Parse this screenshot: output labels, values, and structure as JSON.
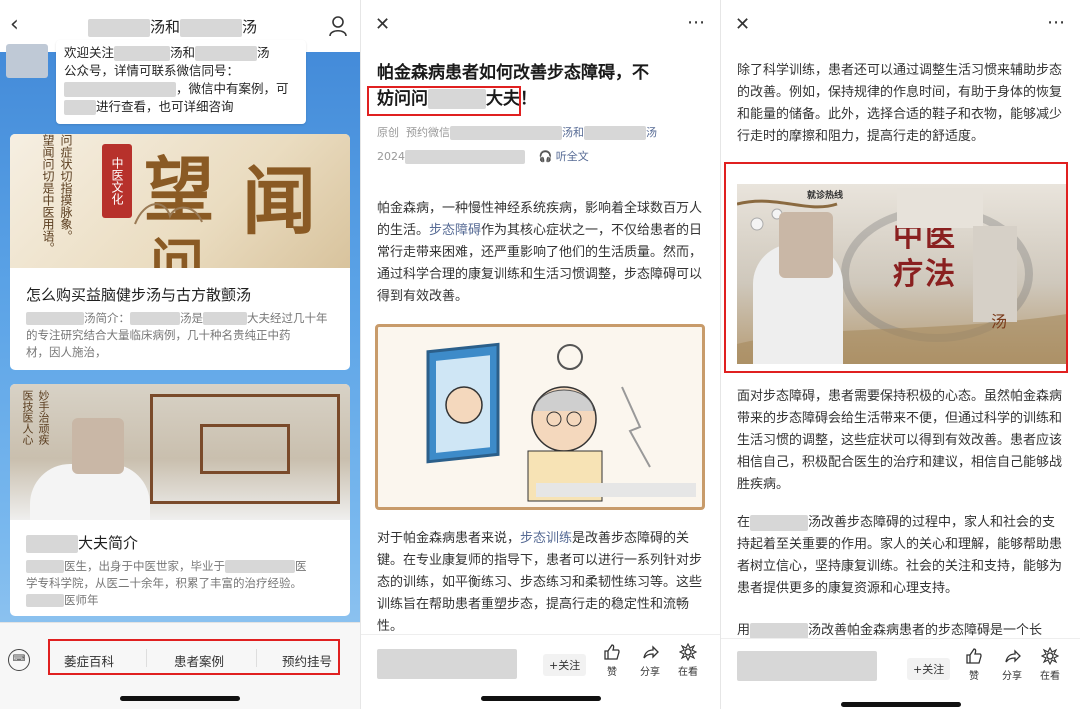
{
  "panel1": {
    "nav_title_a": "汤和",
    "nav_title_b": "汤",
    "welcome": {
      "line1a": "欢迎关注",
      "line1b": "汤和",
      "line1c": "汤",
      "line2": "公众号，详情可联系微信同号：",
      "line3": "，微信中有案例，可",
      "line4": "进行查看，也可详细咨询"
    },
    "card1": {
      "image_vertical_1": "望闻问切是中医用语。",
      "image_vertical_2": "指望气色、闻听声息、",
      "image_vertical_3": "问症状切指摸脉象。",
      "image_tag": "中医文化",
      "image_big_1": "望",
      "image_big_2": "闻",
      "image_big_3": "问",
      "title": "怎么购买益脑健步汤与古方散颤汤",
      "desc_a": "汤简介：",
      "desc_b": "汤是",
      "desc_c": "大夫经过几十年",
      "desc_d": "的专注研究结合大量临床病例，几十种名贵纯正中药",
      "desc_e": "材，因人施治，"
    },
    "card2": {
      "image_vertical_1": "妙手治顽疾",
      "image_vertical_2": "医技医人心",
      "title": "大夫简介",
      "desc_a": "医生，出身于中医世家，毕业于",
      "desc_b": "医",
      "desc_c": "学专科学院，从医二十余年，积累了丰富的治疗经验。",
      "desc_d": "医师年"
    },
    "menu": [
      "萎症百科",
      "患者案例",
      "预约挂号"
    ]
  },
  "panel2": {
    "title_line1": "帕金森病患者如何改善步态障碍，不",
    "title_line2a": "妨问问",
    "title_line2b": "大夫！",
    "meta_original": "原创",
    "meta_a": "预约微信",
    "meta_b": "汤和",
    "meta_c": "汤",
    "meta_date": "2024",
    "listen": "听全文",
    "para1_a": "帕金森病，一种慢性神经系统疾病，影响着全球数百万人的生活。",
    "para1_link": "步态障碍",
    "para1_b": "作为其核心症状之一，不仅给患者的日常行走带来困难，还严重影响了他们的生活质量。然而，通过科学合理的康复训练和生活习惯调整，步态障碍可以得到有效改善。",
    "para2_a": "对于帕金森病患者来说，",
    "para2_link": "步态训练",
    "para2_b": "是改善步态障碍的关键。在专业康复师的指导下，患者可以进行一系列针对步态的训练，如平衡练习、步态练习和柔韧性练习等。这些训练旨在帮助患者重塑步态，提高行走的稳定性和流畅性。",
    "follow": "+关注",
    "actions": [
      "赞",
      "分享",
      "在看"
    ]
  },
  "panel3": {
    "para0": "除了科学训练，患者还可以通过调整生活习惯来辅助步态的改善。例如，保持规律的作息时间，有助于身体的恢复和能量的储备。此外，选择合适的鞋子和衣物，能够减少行走时的摩擦和阻力，提高行走的舒适度。",
    "img_hotline": "就诊热线",
    "img_chars": "中医疗法",
    "img_tang": "汤",
    "para1": "面对步态障碍，患者需要保持积极的心态。虽然帕金森病带来的步态障碍会给生活带来不便，但通过科学的训练和生活习惯的调整，这些症状可以得到有效改善。患者应该相信自己，积极配合医生的治疗和建议，相信自己能够战胜疾病。",
    "para2_a": "在",
    "para2_b": "汤改善步态障碍的过程中，家人和社会的支持起着至关重要的作用。家人的关心和理解，能够帮助患者树立信心，坚持康复训练。社会的关注和支持，能够为患者提供更多的康复资源和心理支持。",
    "para3_a": "用",
    "para3_b": "汤改善帕金森病患者的步态障碍是一个长",
    "follow": "+关注",
    "actions": [
      "赞",
      "分享",
      "在看"
    ]
  },
  "colors": {
    "highlight_border": "#e02020",
    "link": "#576b95",
    "tag_red": "#b7312b"
  }
}
